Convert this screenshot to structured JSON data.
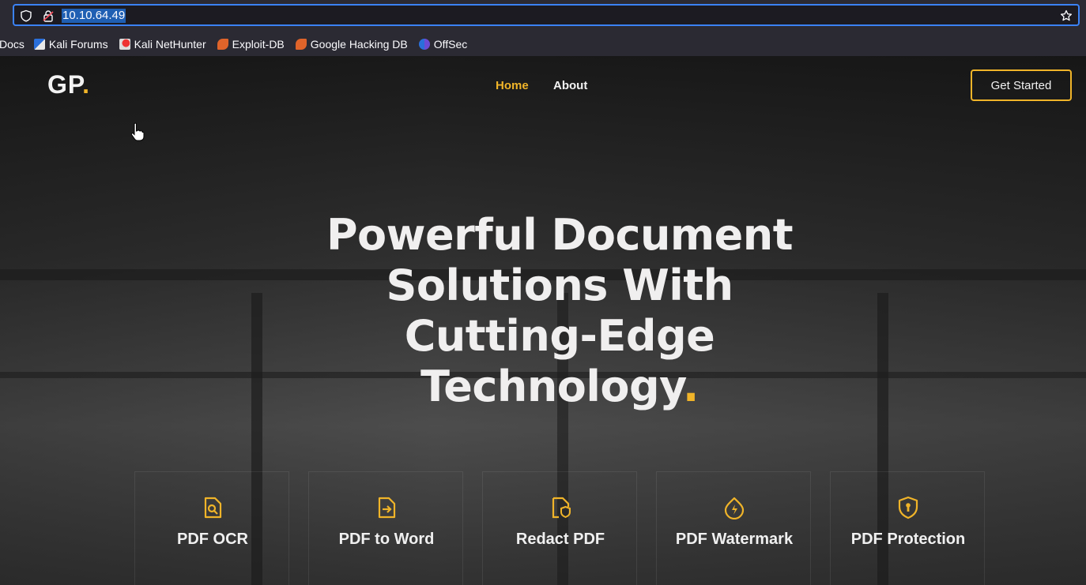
{
  "browser": {
    "url": "10.10.64.49",
    "bookmarks": [
      {
        "label": "Docs",
        "icon": "none"
      },
      {
        "label": "Kali Forums",
        "icon": "kali-forums-icon"
      },
      {
        "label": "Kali NetHunter",
        "icon": "kali-nethunter-icon"
      },
      {
        "label": "Exploit-DB",
        "icon": "exploit-db-icon"
      },
      {
        "label": "Google Hacking DB",
        "icon": "google-hacking-db-icon"
      },
      {
        "label": "OffSec",
        "icon": "offsec-icon"
      }
    ]
  },
  "site": {
    "logo_text": "GP",
    "logo_dot": ".",
    "nav": {
      "home": "Home",
      "about": "About"
    },
    "cta": "Get Started",
    "hero": {
      "line1": "Powerful Document",
      "line2": "Solutions With",
      "line3": "Cutting-Edge",
      "line4": "Technology",
      "dot": "."
    },
    "features": [
      {
        "label": "PDF OCR",
        "icon": "file-search-icon"
      },
      {
        "label": "PDF to Word",
        "icon": "file-arrow-icon"
      },
      {
        "label": "Redact PDF",
        "icon": "file-shield-icon"
      },
      {
        "label": "PDF Watermark",
        "icon": "bolt-icon"
      },
      {
        "label": "PDF Protection",
        "icon": "shield-lock-icon"
      }
    ]
  },
  "colors": {
    "accent": "#f0b429",
    "chrome": "#2b2a33",
    "selection": "#1f5fb3"
  }
}
